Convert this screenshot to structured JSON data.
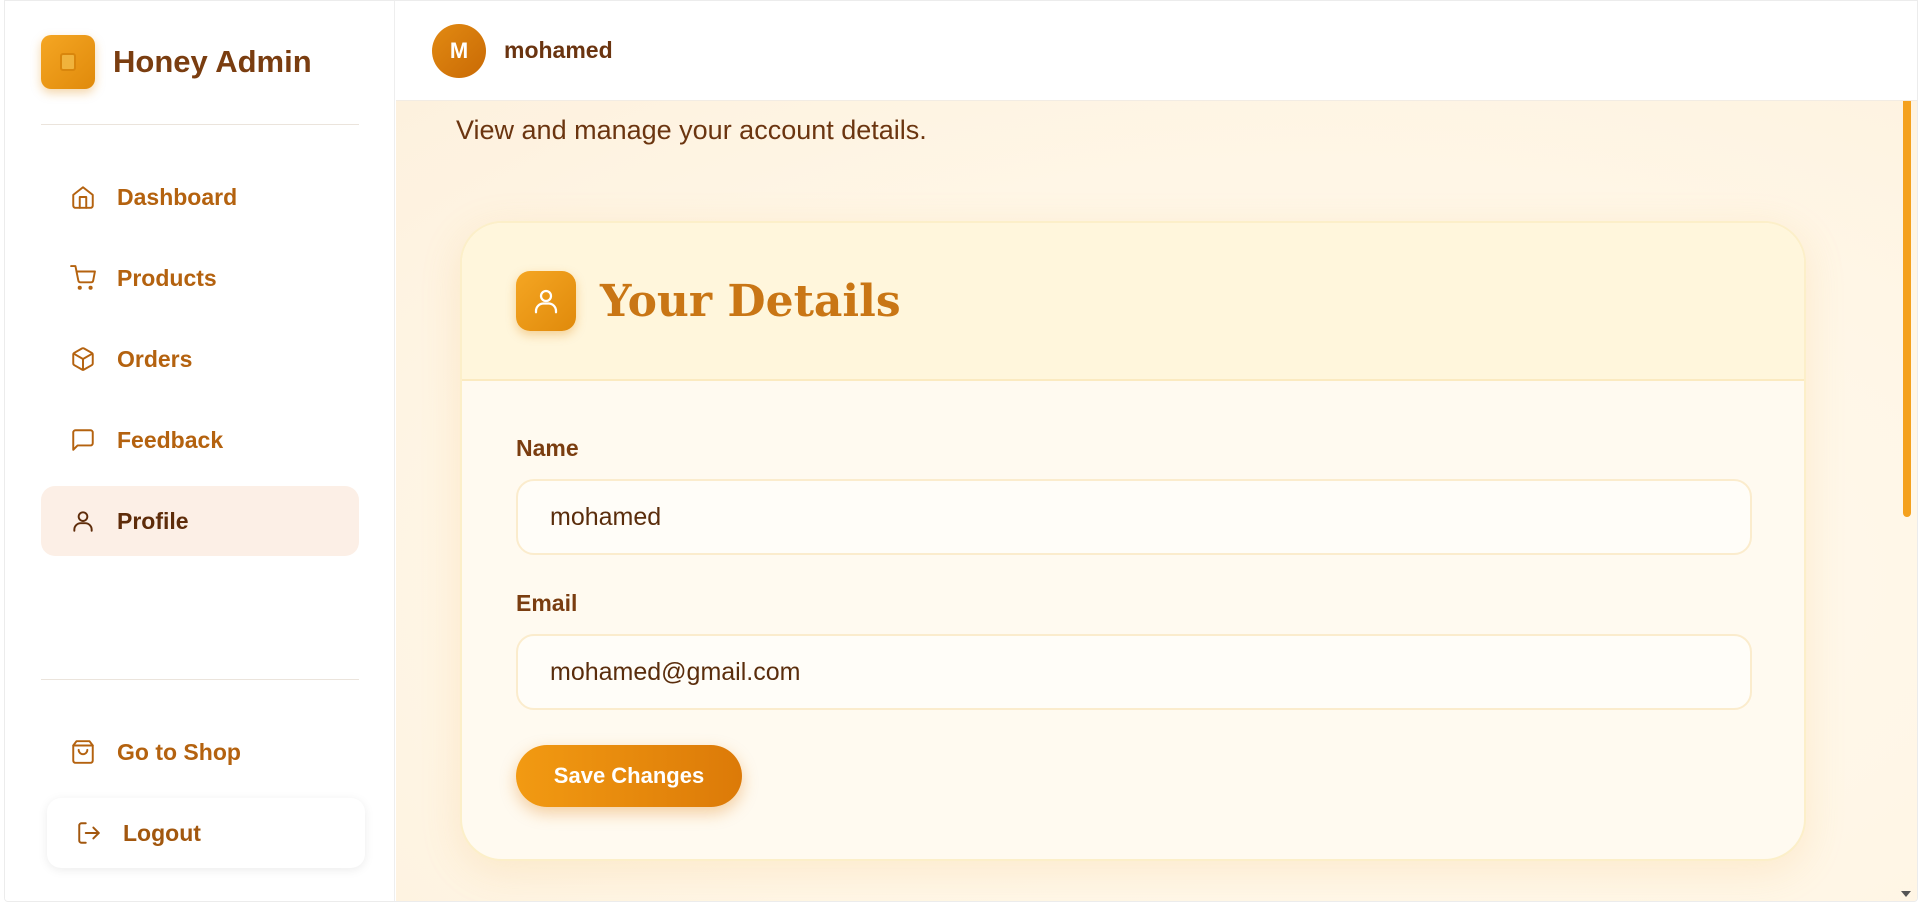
{
  "brand": {
    "name": "Honey Admin"
  },
  "sidebar": {
    "items": [
      {
        "label": "Dashboard",
        "icon": "home-icon"
      },
      {
        "label": "Products",
        "icon": "cart-icon"
      },
      {
        "label": "Orders",
        "icon": "box-icon"
      },
      {
        "label": "Feedback",
        "icon": "message-icon"
      },
      {
        "label": "Profile",
        "icon": "user-icon",
        "active": true
      }
    ],
    "footer": [
      {
        "label": "Go to Shop",
        "icon": "shopping-bag-icon"
      },
      {
        "label": "Logout",
        "icon": "logout-icon"
      }
    ]
  },
  "header": {
    "avatar_initial": "M",
    "username": "mohamed"
  },
  "main": {
    "subtitle": "View and manage your account details.",
    "card": {
      "title": "Your Details",
      "name_label": "Name",
      "name_value": "mohamed",
      "email_label": "Email",
      "email_value": "mohamed@gmail.com",
      "save_label": "Save Changes"
    }
  },
  "colors": {
    "accent": "#f29a12",
    "brand_text": "#7a3d10",
    "nav_text": "#b4620f",
    "active_bg": "#fcefe6"
  }
}
